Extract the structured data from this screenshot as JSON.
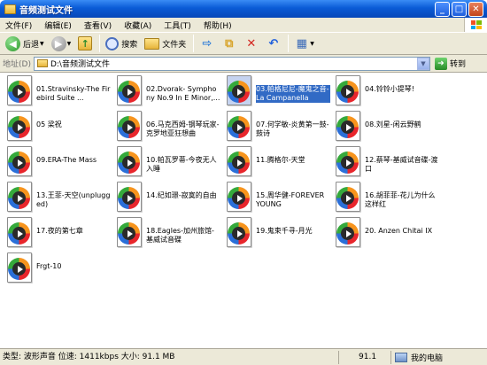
{
  "window": {
    "title": "音频测试文件"
  },
  "menu": [
    "文件(F)",
    "编辑(E)",
    "查看(V)",
    "收藏(A)",
    "工具(T)",
    "帮助(H)"
  ],
  "toolbar": {
    "back_label": "后退",
    "search_label": "搜索",
    "folders_label": "文件夹"
  },
  "address": {
    "label": "地址(D)",
    "value": "D:\\音频测试文件",
    "go_label": "转到"
  },
  "files": [
    {
      "name": "01.Stravinsky-The Firebird Suite ..."
    },
    {
      "name": "02.Dvorak- Symphony No.9 In E Minor,..."
    },
    {
      "name": "03.帕格尼尼-魔鬼之音-La Campanella",
      "selected": true
    },
    {
      "name": "04.铃铃小提琴!"
    },
    {
      "name": "05 梁祝"
    },
    {
      "name": "06.马克西姆-钢琴玩家-克罗地亚狂想曲"
    },
    {
      "name": "07.何学敏-炎黄第一鼓-鼓诗"
    },
    {
      "name": "08.刘星-闲云野鹤"
    },
    {
      "name": "09.ERA-The Mass"
    },
    {
      "name": "10.帕瓦罗蒂-今夜无人入睡"
    },
    {
      "name": "11.腾格尔-天堂"
    },
    {
      "name": "12.蔡琴-基威试音碟-渡口"
    },
    {
      "name": "13.王菲-天空(unplugged)"
    },
    {
      "name": "14.纪如璟-寂寞的自由"
    },
    {
      "name": "15.周华健-FOREVER YOUNG"
    },
    {
      "name": "16.胡菲菲-花儿为什么这样红"
    },
    {
      "name": "17.夜的第七章"
    },
    {
      "name": "18.Eagles-加州旅馆-基威试音碟"
    },
    {
      "name": "19.鬼束千寻-月光"
    },
    {
      "name": "20. Anzen Chitai IX"
    },
    {
      "name": "Frgt-10"
    }
  ],
  "status": {
    "info": "类型: 波形声音 位速: 1411kbps 大小: 91.1 MB",
    "size": "91.1 MB",
    "location": "我的电脑"
  },
  "colors": {
    "titlebar": "#0a5bd6",
    "selection": "#316ac5",
    "chrome": "#ece9d8"
  }
}
